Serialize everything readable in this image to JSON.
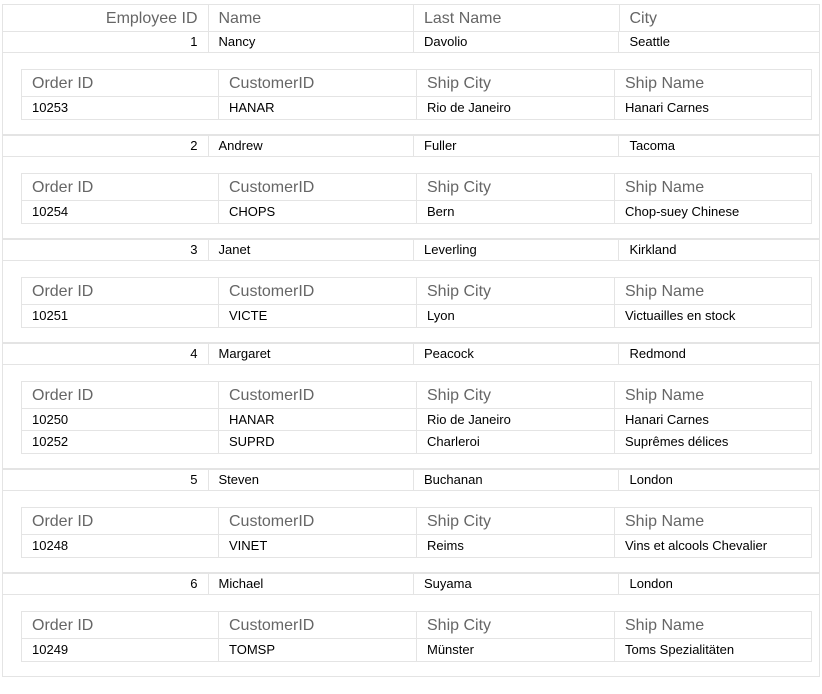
{
  "master": {
    "columns": [
      "Employee ID",
      "Name",
      "Last Name",
      "City"
    ],
    "rows": [
      {
        "id": "1",
        "name": "Nancy",
        "last": "Davolio",
        "city": "Seattle",
        "detail": {
          "columns": [
            "Order ID",
            "CustomerID",
            "Ship City",
            "Ship Name"
          ],
          "rows": [
            [
              "10253",
              "HANAR",
              "Rio de Janeiro",
              "Hanari Carnes"
            ]
          ]
        }
      },
      {
        "id": "2",
        "name": "Andrew",
        "last": "Fuller",
        "city": "Tacoma",
        "detail": {
          "columns": [
            "Order ID",
            "CustomerID",
            "Ship City",
            "Ship Name"
          ],
          "rows": [
            [
              "10254",
              "CHOPS",
              "Bern",
              "Chop-suey Chinese"
            ]
          ]
        }
      },
      {
        "id": "3",
        "name": "Janet",
        "last": "Leverling",
        "city": "Kirkland",
        "detail": {
          "columns": [
            "Order ID",
            "CustomerID",
            "Ship City",
            "Ship Name"
          ],
          "rows": [
            [
              "10251",
              "VICTE",
              "Lyon",
              "Victuailles en stock"
            ]
          ]
        }
      },
      {
        "id": "4",
        "name": "Margaret",
        "last": "Peacock",
        "city": "Redmond",
        "detail": {
          "columns": [
            "Order ID",
            "CustomerID",
            "Ship City",
            "Ship Name"
          ],
          "rows": [
            [
              "10250",
              "HANAR",
              "Rio de Janeiro",
              "Hanari Carnes"
            ],
            [
              "10252",
              "SUPRD",
              "Charleroi",
              "Suprêmes délices"
            ]
          ]
        }
      },
      {
        "id": "5",
        "name": "Steven",
        "last": "Buchanan",
        "city": "London",
        "detail": {
          "columns": [
            "Order ID",
            "CustomerID",
            "Ship City",
            "Ship Name"
          ],
          "rows": [
            [
              "10248",
              "VINET",
              "Reims",
              "Vins et alcools Chevalier"
            ]
          ]
        }
      },
      {
        "id": "6",
        "name": "Michael",
        "last": "Suyama",
        "city": "London",
        "detail": {
          "columns": [
            "Order ID",
            "CustomerID",
            "Ship City",
            "Ship Name"
          ],
          "rows": [
            [
              "10249",
              "TOMSP",
              "Münster",
              "Toms Spezialitäten"
            ]
          ]
        }
      }
    ]
  }
}
